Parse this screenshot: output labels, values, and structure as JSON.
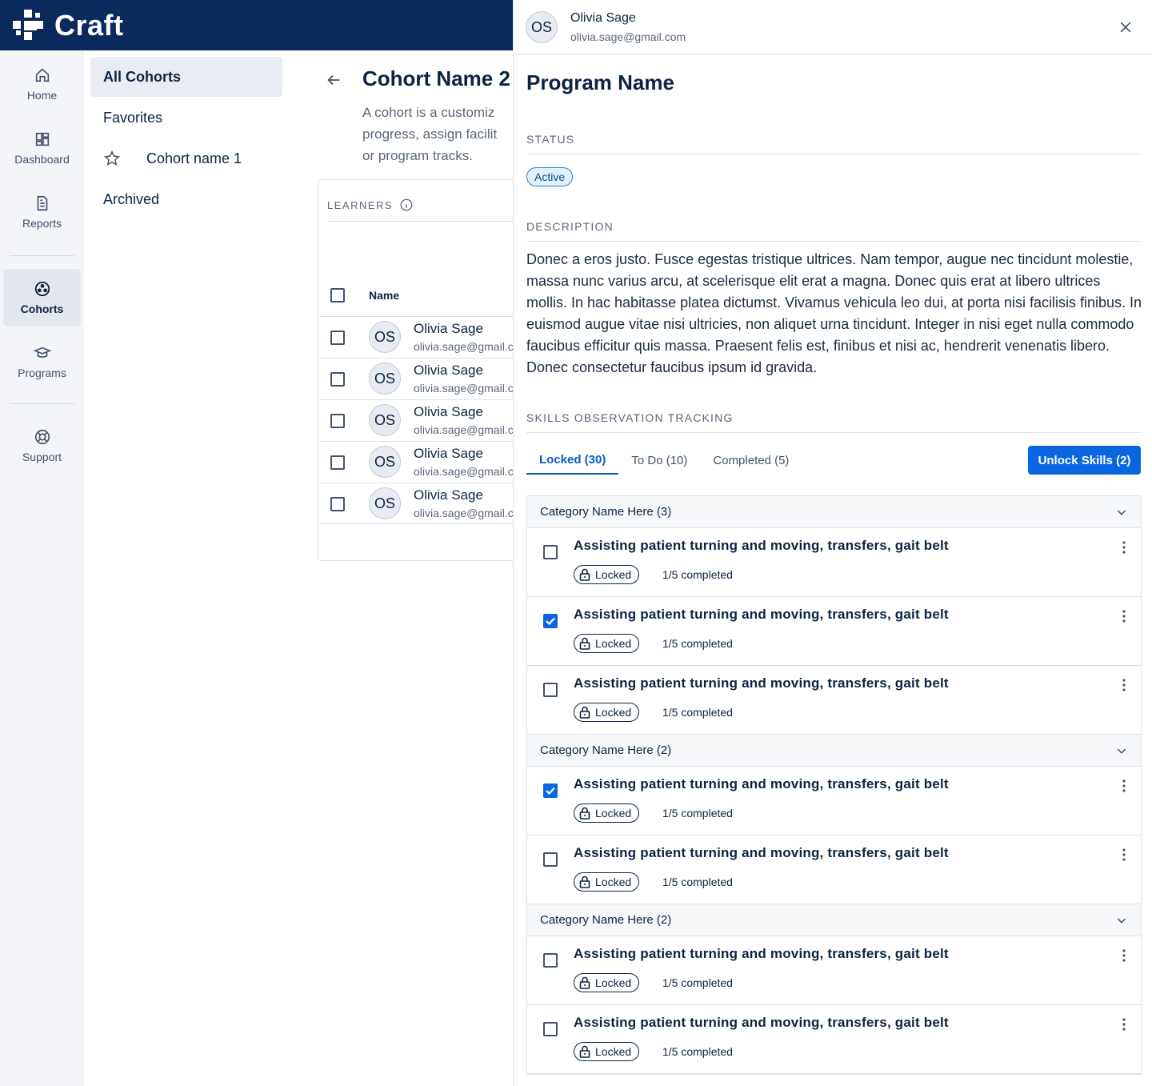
{
  "app": {
    "name": "Craft"
  },
  "nav": {
    "items": [
      {
        "label": "Home",
        "icon": "home-icon"
      },
      {
        "label": "Dashboard",
        "icon": "dashboard-icon"
      },
      {
        "label": "Reports",
        "icon": "reports-icon"
      },
      {
        "label": "Cohorts",
        "icon": "cohorts-icon",
        "active": true
      },
      {
        "label": "Programs",
        "icon": "programs-icon"
      },
      {
        "label": "Support",
        "icon": "support-icon"
      }
    ]
  },
  "cohorts_menu": {
    "all": "All Cohorts",
    "favorites": "Favorites",
    "favorite_item": "Cohort name 1",
    "archived": "Archived"
  },
  "main": {
    "title": "Cohort Name 2",
    "description_lines": [
      "A cohort is a customiz",
      "progress, assign facilit",
      "or program tracks."
    ],
    "learners_label": "LEARNERS",
    "name_column": "Name",
    "learners": [
      {
        "initials": "OS",
        "name": "Olivia Sage",
        "email": "olivia.sage@gmail.c"
      },
      {
        "initials": "OS",
        "name": "Olivia Sage",
        "email": "olivia.sage@gmail.c"
      },
      {
        "initials": "OS",
        "name": "Olivia Sage",
        "email": "olivia.sage@gmail.c"
      },
      {
        "initials": "OS",
        "name": "Olivia Sage",
        "email": "olivia.sage@gmail.c"
      },
      {
        "initials": "OS",
        "name": "Olivia Sage",
        "email": "olivia.sage@gmail.c"
      }
    ]
  },
  "drawer": {
    "user": {
      "initials": "OS",
      "name": "Olivia Sage",
      "email": "olivia.sage@gmail.com"
    },
    "program_title": "Program Name",
    "status_label": "STATUS",
    "status_value": "Active",
    "description_label": "DESCRIPTION",
    "description": "Donec a eros justo. Fusce egestas tristique ultrices. Nam tempor, augue nec tincidunt molestie, massa nunc varius arcu, at scelerisque elit erat a magna. Donec quis erat at libero ultrices mollis. In hac habitasse platea dictumst. Vivamus vehicula leo dui, at porta nisi facilisis finibus. In euismod augue vitae nisi ultricies, non aliquet urna tincidunt. Integer in nisi eget nulla commodo faucibus efficitur quis massa. Praesent felis est, finibus et nisi ac, hendrerit venenatis libero. Donec consectetur faucibus ipsum id gravida.",
    "skills_label": "SKILLS OBSERVATION TRACKING",
    "tabs": [
      {
        "label": "Locked (30)",
        "active": true
      },
      {
        "label": "To Do (10)",
        "active": false
      },
      {
        "label": "Completed (5)",
        "active": false
      }
    ],
    "unlock_button": "Unlock Skills (2)",
    "categories": [
      {
        "name": "Category Name Here (3)",
        "skills": [
          {
            "title": "Assisting patient turning and moving, transfers, gait belt",
            "status": "Locked",
            "progress": "1/5 completed",
            "checked": false
          },
          {
            "title": "Assisting patient turning and moving, transfers, gait belt",
            "status": "Locked",
            "progress": "1/5 completed",
            "checked": true
          },
          {
            "title": "Assisting patient turning and moving, transfers, gait belt",
            "status": "Locked",
            "progress": "1/5 completed",
            "checked": false
          }
        ]
      },
      {
        "name": "Category Name Here (2)",
        "skills": [
          {
            "title": "Assisting patient turning and moving, transfers, gait belt",
            "status": "Locked",
            "progress": "1/5 completed",
            "checked": true
          },
          {
            "title": "Assisting patient turning and moving, transfers, gait belt",
            "status": "Locked",
            "progress": "1/5 completed",
            "checked": false
          }
        ]
      },
      {
        "name": "Category Name Here (2)",
        "skills": [
          {
            "title": "Assisting patient turning and moving, transfers, gait belt",
            "status": "Locked",
            "progress": "1/5 completed",
            "checked": false
          },
          {
            "title": "Assisting patient turning and moving, transfers, gait belt",
            "status": "Locked",
            "progress": "1/5 completed",
            "checked": false
          }
        ]
      }
    ]
  },
  "colors": {
    "topbar": "#0a2a5c",
    "accent": "#0a66e0",
    "status_bg": "#dff1fb"
  }
}
